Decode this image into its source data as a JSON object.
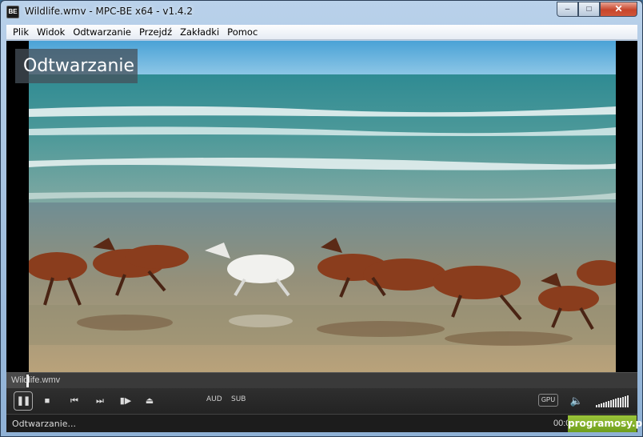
{
  "window": {
    "title": "Wildlife.wmv - MPC-BE x64 - v1.4.2",
    "app_icon": "clapperboard-icon",
    "controls": {
      "minimize": "–",
      "maximize": "□",
      "close": "✕"
    }
  },
  "menu": {
    "items": [
      "Plik",
      "Widok",
      "Odtwarzanie",
      "Przejdź",
      "Zakładki",
      "Pomoc"
    ]
  },
  "video": {
    "osd_text": "Odtwarzanie",
    "scene": "horses galloping on beach"
  },
  "seekbar": {
    "file_label": "Wildlife.wmv",
    "progress": 0.03
  },
  "toolbar": {
    "pause_icon": "pause-icon",
    "stop_icon": "stop-icon",
    "prev_icon": "skip-back-icon",
    "next_icon": "skip-forward-icon",
    "frame_step_icon": "frame-step-icon",
    "eject_icon": "eject-icon",
    "aud_label": "AUD",
    "sub_label": "SUB",
    "gpu_label": "GPU",
    "volume_icon": "speaker-icon",
    "volume_level": 1.0
  },
  "status": {
    "text": "Odtwarzanie...",
    "time_partial": "00:0",
    "watermark": "programosy.pl"
  },
  "colors": {
    "titlebar": "#b9d1ea",
    "close_button": "#c7452b",
    "player_dark": "#232323",
    "watermark_green": "#8ab832"
  }
}
